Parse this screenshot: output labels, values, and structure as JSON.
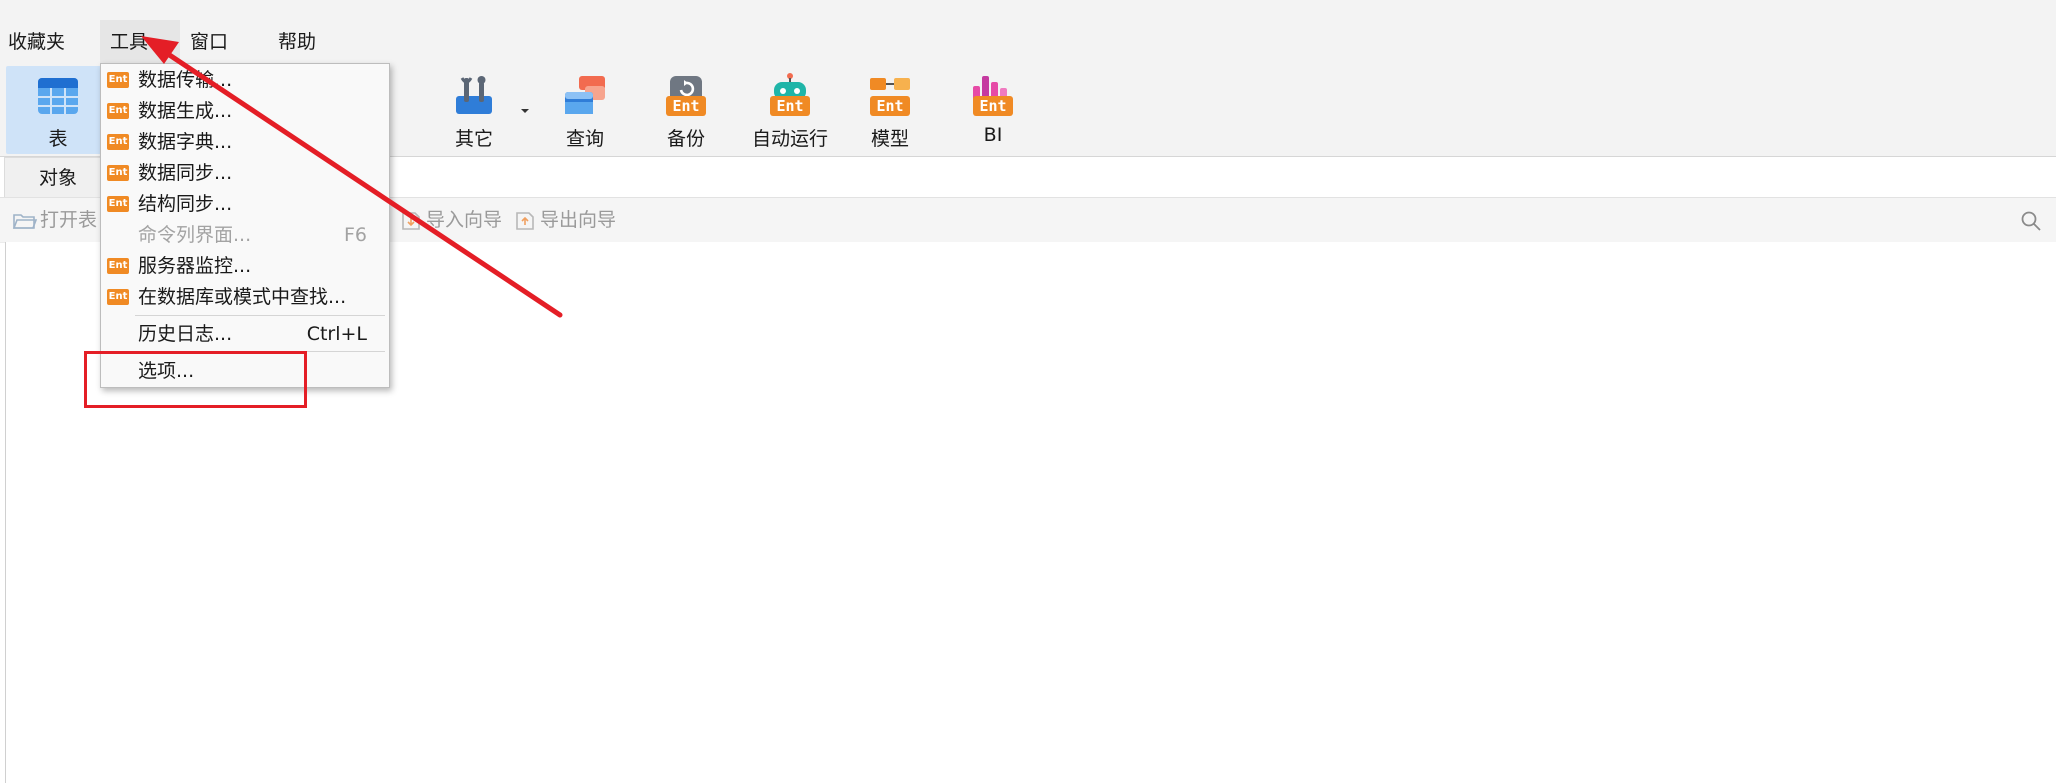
{
  "menubar": {
    "items": [
      {
        "label": "收藏夹"
      },
      {
        "label": "工具"
      },
      {
        "label": "窗口"
      },
      {
        "label": "帮助"
      }
    ]
  },
  "toolbar": {
    "table_label": "表",
    "other_label": "其它",
    "query_label": "查询",
    "backup_label": "备份",
    "automation_label": "自动运行",
    "model_label": "模型",
    "bi_label": "BI",
    "ent_badge": "Ent"
  },
  "tabs": {
    "objects_label": "对象"
  },
  "objbar": {
    "open_table": "打开表",
    "import_wizard": "导入向导",
    "export_wizard": "导出向导"
  },
  "tools_menu": {
    "items": [
      {
        "label": "数据传输...",
        "badge": "Ent",
        "shortcut": "",
        "enabled": true
      },
      {
        "label": "数据生成...",
        "badge": "Ent",
        "shortcut": "",
        "enabled": true
      },
      {
        "label": "数据字典...",
        "badge": "Ent",
        "shortcut": "",
        "enabled": true
      },
      {
        "label": "数据同步...",
        "badge": "Ent",
        "shortcut": "",
        "enabled": true
      },
      {
        "label": "结构同步...",
        "badge": "Ent",
        "shortcut": "",
        "enabled": true
      },
      {
        "label": "命令列界面...",
        "badge": "",
        "shortcut": "F6",
        "enabled": false
      },
      {
        "label": "服务器监控...",
        "badge": "Ent",
        "shortcut": "",
        "enabled": true
      },
      {
        "label": "在数据库或模式中查找...",
        "badge": "Ent",
        "shortcut": "",
        "enabled": true
      },
      {
        "label": "历史日志...",
        "badge": "",
        "shortcut": "Ctrl+L",
        "enabled": true
      },
      {
        "label": "选项...",
        "badge": "",
        "shortcut": "",
        "enabled": true
      }
    ]
  },
  "colors": {
    "accent_red": "#e41e26",
    "ent_orange": "#f08a24",
    "active_tool_bg": "#cfe3f8"
  }
}
